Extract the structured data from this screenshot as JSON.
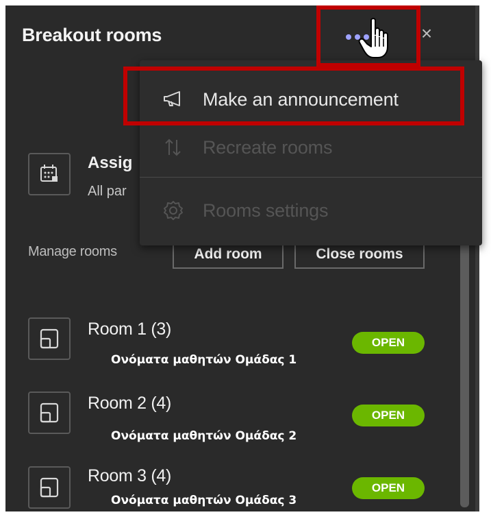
{
  "header": {
    "title": "Breakout rooms",
    "more_icon": "more-options-icon",
    "close_icon": "close-icon",
    "close_glyph": "×"
  },
  "menu": {
    "items": [
      {
        "label": "Make an announcement",
        "icon": "megaphone-icon",
        "enabled": true
      },
      {
        "label": "Recreate rooms",
        "icon": "swap-arrows-icon",
        "enabled": false
      },
      {
        "label": "Rooms settings",
        "icon": "gear-icon",
        "enabled": false
      }
    ]
  },
  "assign": {
    "title": "Assig",
    "subtitle": "All par",
    "icon": "calendar-grid-icon"
  },
  "manage": {
    "label": "Manage rooms",
    "add_room": "Add room",
    "close_rooms": "Close rooms"
  },
  "rooms": [
    {
      "name": "Room 1 (3)",
      "members": "Ονόματα μαθητών Ομάδας 1",
      "status": "OPEN"
    },
    {
      "name": "Room 2 (4)",
      "members": "Ονόματα μαθητών Ομάδας 2",
      "status": "OPEN"
    },
    {
      "name": "Room 3 (4)",
      "members": "Ονόματα μαθητών Ομάδας 3",
      "status": "OPEN"
    }
  ],
  "colors": {
    "panel_bg": "#2a2a2a",
    "menu_bg": "#2d2d2d",
    "accent_dots": "#9ea2ff",
    "open_badge": "#6bb700",
    "highlight": "#c00000"
  }
}
